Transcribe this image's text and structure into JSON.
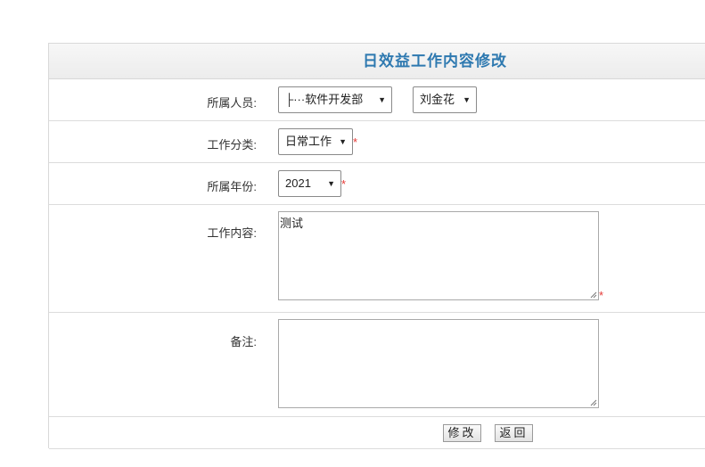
{
  "form": {
    "title": "日效益工作内容修改",
    "fields": {
      "member": {
        "label": "所属人员:",
        "department_value": "├···软件开发部",
        "person_value": "刘金花"
      },
      "category": {
        "label": "工作分类:",
        "value": "日常工作",
        "required": "*"
      },
      "year": {
        "label": "所属年份:",
        "value": "2021",
        "required": "*"
      },
      "content": {
        "label": "工作内容:",
        "value": "测试",
        "required": "*"
      },
      "remark": {
        "label": "备注:",
        "value": ""
      }
    },
    "buttons": {
      "modify": "修改",
      "back": "返回"
    }
  },
  "icons": {
    "dropdown": "chevron-down-icon",
    "resize": "resize-grip-icon"
  },
  "colors": {
    "title": "#2e79b0",
    "required": "#e53935",
    "header_bg": "#f0f0f0"
  }
}
